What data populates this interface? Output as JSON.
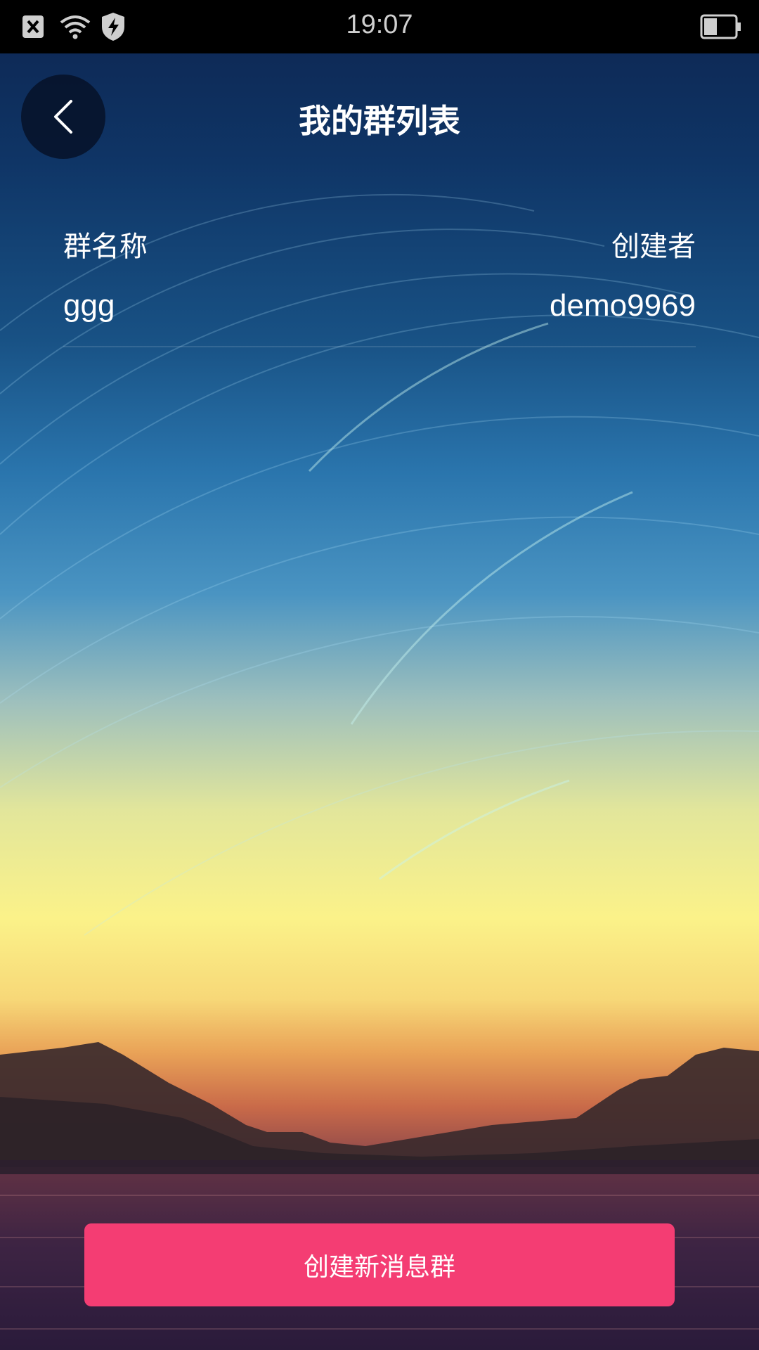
{
  "status_bar": {
    "time": "19:07"
  },
  "header": {
    "title": "我的群列表"
  },
  "table": {
    "columns": [
      "群名称",
      "创建者"
    ],
    "rows": [
      {
        "name": "ggg",
        "creator": "demo9969"
      }
    ]
  },
  "actions": {
    "create_label": "创建新消息群"
  },
  "colors": {
    "accent": "#f43d73"
  }
}
